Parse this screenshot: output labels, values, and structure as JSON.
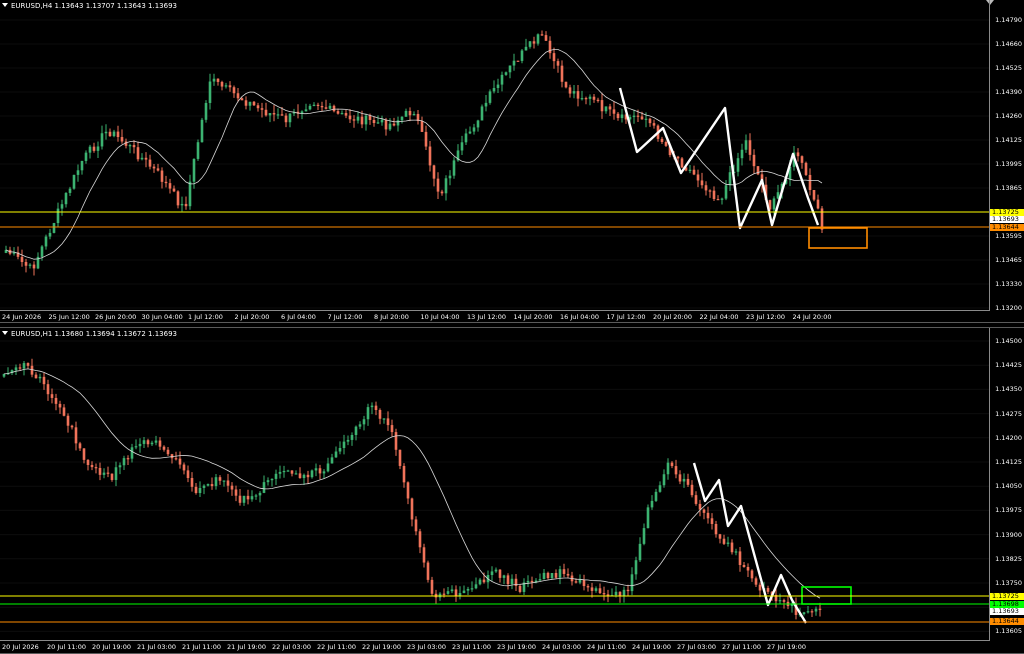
{
  "charts": [
    {
      "id": "h4",
      "header": "EURUSD,H4  1.13643 1.13707 1.13643 1.13693",
      "price_ticks": [
        "1.14790",
        "1.14660",
        "1.14525",
        "1.14390",
        "1.14260",
        "1.14125",
        "1.13995",
        "1.13865",
        "1.13725",
        "1.13595",
        "1.13465",
        "1.13330",
        "1.13200"
      ],
      "time_ticks": [
        "24 Jun 2026",
        "25 Jun 12:00",
        "26 Jun 20:00",
        "30 Jun 04:00",
        "1 Jul 12:00",
        "2 Jul 20:00",
        "6 Jul 04:00",
        "7 Jul 12:00",
        "8 Jul 20:00",
        "10 Jul 04:00",
        "13 Jul 12:00",
        "14 Jul 20:00",
        "16 Jul 04:00",
        "17 Jul 12:00",
        "20 Jul 20:00",
        "22 Jul 04:00",
        "23 Jul 12:00",
        "24 Jul 20:00"
      ],
      "levels": [
        {
          "label": "1.13725",
          "color": "#ffff00"
        },
        {
          "label": "1.13693",
          "color": "#ffffff"
        },
        {
          "label": "1.13644",
          "color": "#ff8c00"
        }
      ]
    },
    {
      "id": "h1",
      "header": "EURUSD,H1  1.13680 1.13694 1.13672 1.13693",
      "price_ticks": [
        "1.14500",
        "1.14425",
        "1.14350",
        "1.14275",
        "1.14200",
        "1.14125",
        "1.14050",
        "1.13975",
        "1.13900",
        "1.13825",
        "1.13750",
        "1.13675",
        "1.13605"
      ],
      "time_ticks": [
        "20 Jul 2026",
        "20 Jul 11:00",
        "20 Jul 19:00",
        "21 Jul 03:00",
        "21 Jul 11:00",
        "21 Jul 19:00",
        "22 Jul 03:00",
        "22 Jul 11:00",
        "22 Jul 19:00",
        "23 Jul 03:00",
        "23 Jul 11:00",
        "23 Jul 19:00",
        "24 Jul 03:00",
        "24 Jul 11:00",
        "24 Jul 19:00",
        "27 Jul 03:00",
        "27 Jul 11:00",
        "27 Jul 19:00"
      ],
      "levels": [
        {
          "label": "1.13725",
          "color": "#ffff00"
        },
        {
          "label": "1.13698",
          "color": "#00ff00"
        },
        {
          "label": "1.13693",
          "color": "#ffffff"
        },
        {
          "label": "1.13644",
          "color": "#ff8c00"
        }
      ]
    }
  ],
  "colors": {
    "bull": "#3cb371",
    "bear": "#f0735a",
    "ma": "#d8d8d8",
    "zigzag": "#ffffff",
    "support": "#ff8c00",
    "resistance": "#ffff00",
    "target_box_h4": "#ff8c00",
    "target_box_h1": "#00ff00"
  }
}
